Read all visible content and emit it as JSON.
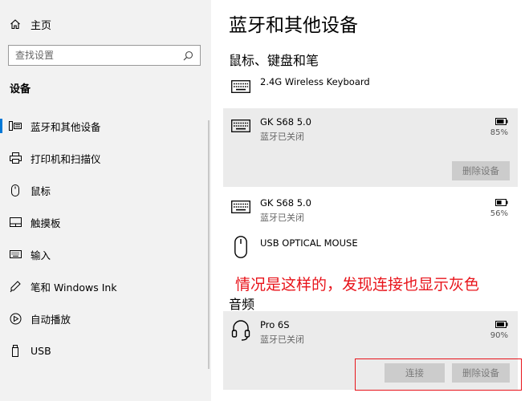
{
  "sidebar": {
    "home_label": "主页",
    "search_placeholder": "查找设置",
    "section_label": "设备",
    "items": [
      {
        "label": "蓝牙和其他设备",
        "icon": "bluetooth-devices-icon"
      },
      {
        "label": "打印机和扫描仪",
        "icon": "printer-icon"
      },
      {
        "label": "鼠标",
        "icon": "mouse-icon"
      },
      {
        "label": "触摸板",
        "icon": "touchpad-icon"
      },
      {
        "label": "输入",
        "icon": "keyboard-icon"
      },
      {
        "label": "笔和 Windows Ink",
        "icon": "pen-icon"
      },
      {
        "label": "自动播放",
        "icon": "autoplay-icon"
      },
      {
        "label": "USB",
        "icon": "usb-icon"
      }
    ]
  },
  "main": {
    "title": "蓝牙和其他设备",
    "section_mouse_keyboard": "鼠标、键盘和笔",
    "section_audio": "音频",
    "devices": [
      {
        "name": "2.4G Wireless Keyboard",
        "status": "",
        "battery": "",
        "icon": "keyboard-icon"
      },
      {
        "name": "GK S68 5.0",
        "status": "蓝牙已关闭",
        "battery": "85%",
        "battery_level": 0.85,
        "icon": "keyboard-icon",
        "remove_label": "删除设备"
      },
      {
        "name": "GK S68 5.0",
        "status": "蓝牙已关闭",
        "battery": "56%",
        "battery_level": 0.56,
        "icon": "keyboard-icon"
      },
      {
        "name": "USB OPTICAL MOUSE",
        "status": "",
        "battery": "",
        "icon": "mouse-icon"
      },
      {
        "name": "Pro 6S",
        "status": "蓝牙已关闭",
        "battery": "90%",
        "battery_level": 0.9,
        "icon": "headset-icon",
        "connect_label": "连接",
        "remove_label": "删除设备"
      }
    ],
    "annotation": "情况是这样的，发现连接也显示灰色"
  },
  "colors": {
    "accent": "#0078d7",
    "annotation": "#e8141b",
    "disabled_button_bg": "#cccccc",
    "selected_row_bg": "#ebebeb",
    "sidebar_bg": "#f2f2f2"
  }
}
